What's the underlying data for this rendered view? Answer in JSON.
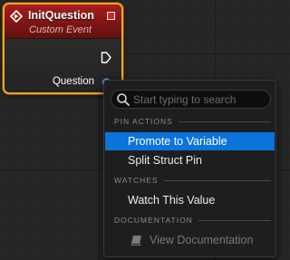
{
  "node": {
    "title": "InitQuestion",
    "subtitle": "Custom Event",
    "output_pin_label": "Question",
    "icons": [
      "custom-event-icon",
      "delegate-pin-icon",
      "exec-output-icon",
      "struct-pin-icon"
    ],
    "colors": {
      "border": "#f2a623",
      "header": "#a81d1d",
      "delegate_pin": "#e51e2a",
      "struct_pin": "#1f5aa8"
    }
  },
  "context_menu": {
    "search_placeholder": "Start typing to search",
    "search_value": "",
    "sections": [
      {
        "header": "PIN ACTIONS",
        "items": [
          {
            "label": "Promote to Variable",
            "selected": true,
            "enabled": true
          },
          {
            "label": "Split Struct Pin",
            "selected": false,
            "enabled": true
          }
        ]
      },
      {
        "header": "WATCHES",
        "items": [
          {
            "label": "Watch This Value",
            "selected": false,
            "enabled": true
          }
        ]
      },
      {
        "header": "DOCUMENTATION",
        "items": [
          {
            "label": "View Documentation",
            "selected": false,
            "enabled": false,
            "icon": "book-icon"
          }
        ]
      }
    ],
    "colors": {
      "highlight": "#0c73da",
      "background": "#1e1e1e"
    }
  }
}
